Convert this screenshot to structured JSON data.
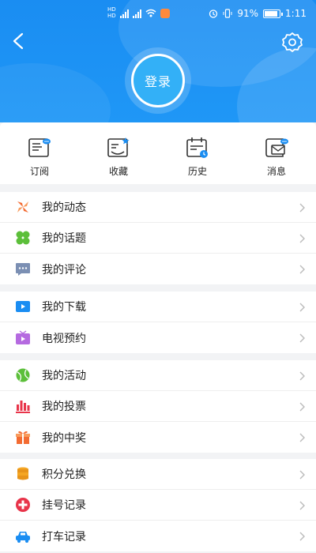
{
  "status_bar": {
    "signal_label_1": "HD",
    "signal_label_2": "HD",
    "battery_percent": "91%",
    "time": "1:11",
    "battery_level": 0.91
  },
  "header": {
    "back_icon": "chevron-left-icon",
    "settings_icon": "gear-icon",
    "login_label": "登录"
  },
  "quick_actions": [
    {
      "label": "订阅",
      "icon": "subscribe-icon"
    },
    {
      "label": "收藏",
      "icon": "favorite-icon"
    },
    {
      "label": "历史",
      "icon": "history-icon"
    },
    {
      "label": "消息",
      "icon": "message-icon"
    }
  ],
  "menu": {
    "group1": [
      {
        "label": "我的动态",
        "icon": "activity-feed-icon"
      },
      {
        "label": "我的话题",
        "icon": "topic-icon"
      },
      {
        "label": "我的评论",
        "icon": "comment-icon"
      }
    ],
    "group2": [
      {
        "label": "我的下载",
        "icon": "download-icon"
      },
      {
        "label": "电视预约",
        "icon": "tv-reservation-icon"
      }
    ],
    "group3": [
      {
        "label": "我的活动",
        "icon": "event-icon"
      },
      {
        "label": "我的投票",
        "icon": "vote-icon"
      },
      {
        "label": "我的中奖",
        "icon": "prize-icon"
      }
    ],
    "group4": [
      {
        "label": "积分兑换",
        "icon": "points-icon"
      },
      {
        "label": "挂号记录",
        "icon": "registration-icon"
      },
      {
        "label": "打车记录",
        "icon": "taxi-icon"
      }
    ]
  },
  "colors": {
    "header_blue": "#1a8df2",
    "accent_orange": "#f36b32",
    "accent_green": "#5cbf3a",
    "accent_purple": "#b56ae0",
    "accent_red": "#e8344a"
  }
}
